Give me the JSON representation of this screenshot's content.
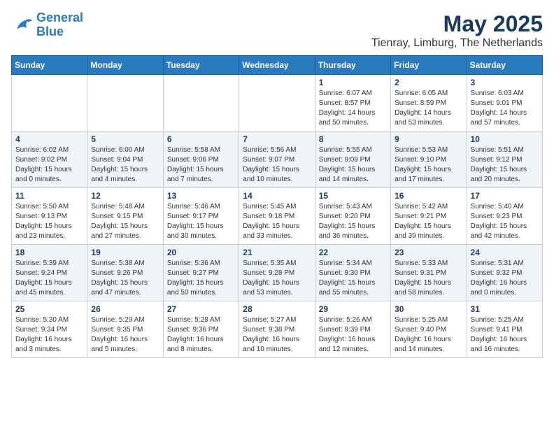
{
  "logo": {
    "line1": "General",
    "line2": "Blue"
  },
  "title": "May 2025",
  "location": "Tienray, Limburg, The Netherlands",
  "weekdays": [
    "Sunday",
    "Monday",
    "Tuesday",
    "Wednesday",
    "Thursday",
    "Friday",
    "Saturday"
  ],
  "weeks": [
    [
      {
        "day": "",
        "info": ""
      },
      {
        "day": "",
        "info": ""
      },
      {
        "day": "",
        "info": ""
      },
      {
        "day": "",
        "info": ""
      },
      {
        "day": "1",
        "info": "Sunrise: 6:07 AM\nSunset: 8:57 PM\nDaylight: 14 hours\nand 50 minutes."
      },
      {
        "day": "2",
        "info": "Sunrise: 6:05 AM\nSunset: 8:59 PM\nDaylight: 14 hours\nand 53 minutes."
      },
      {
        "day": "3",
        "info": "Sunrise: 6:03 AM\nSunset: 9:01 PM\nDaylight: 14 hours\nand 57 minutes."
      }
    ],
    [
      {
        "day": "4",
        "info": "Sunrise: 6:02 AM\nSunset: 9:02 PM\nDaylight: 15 hours\nand 0 minutes."
      },
      {
        "day": "5",
        "info": "Sunrise: 6:00 AM\nSunset: 9:04 PM\nDaylight: 15 hours\nand 4 minutes."
      },
      {
        "day": "6",
        "info": "Sunrise: 5:58 AM\nSunset: 9:06 PM\nDaylight: 15 hours\nand 7 minutes."
      },
      {
        "day": "7",
        "info": "Sunrise: 5:56 AM\nSunset: 9:07 PM\nDaylight: 15 hours\nand 10 minutes."
      },
      {
        "day": "8",
        "info": "Sunrise: 5:55 AM\nSunset: 9:09 PM\nDaylight: 15 hours\nand 14 minutes."
      },
      {
        "day": "9",
        "info": "Sunrise: 5:53 AM\nSunset: 9:10 PM\nDaylight: 15 hours\nand 17 minutes."
      },
      {
        "day": "10",
        "info": "Sunrise: 5:51 AM\nSunset: 9:12 PM\nDaylight: 15 hours\nand 20 minutes."
      }
    ],
    [
      {
        "day": "11",
        "info": "Sunrise: 5:50 AM\nSunset: 9:13 PM\nDaylight: 15 hours\nand 23 minutes."
      },
      {
        "day": "12",
        "info": "Sunrise: 5:48 AM\nSunset: 9:15 PM\nDaylight: 15 hours\nand 27 minutes."
      },
      {
        "day": "13",
        "info": "Sunrise: 5:46 AM\nSunset: 9:17 PM\nDaylight: 15 hours\nand 30 minutes."
      },
      {
        "day": "14",
        "info": "Sunrise: 5:45 AM\nSunset: 9:18 PM\nDaylight: 15 hours\nand 33 minutes."
      },
      {
        "day": "15",
        "info": "Sunrise: 5:43 AM\nSunset: 9:20 PM\nDaylight: 15 hours\nand 36 minutes."
      },
      {
        "day": "16",
        "info": "Sunrise: 5:42 AM\nSunset: 9:21 PM\nDaylight: 15 hours\nand 39 minutes."
      },
      {
        "day": "17",
        "info": "Sunrise: 5:40 AM\nSunset: 9:23 PM\nDaylight: 15 hours\nand 42 minutes."
      }
    ],
    [
      {
        "day": "18",
        "info": "Sunrise: 5:39 AM\nSunset: 9:24 PM\nDaylight: 15 hours\nand 45 minutes."
      },
      {
        "day": "19",
        "info": "Sunrise: 5:38 AM\nSunset: 9:26 PM\nDaylight: 15 hours\nand 47 minutes."
      },
      {
        "day": "20",
        "info": "Sunrise: 5:36 AM\nSunset: 9:27 PM\nDaylight: 15 hours\nand 50 minutes."
      },
      {
        "day": "21",
        "info": "Sunrise: 5:35 AM\nSunset: 9:28 PM\nDaylight: 15 hours\nand 53 minutes."
      },
      {
        "day": "22",
        "info": "Sunrise: 5:34 AM\nSunset: 9:30 PM\nDaylight: 15 hours\nand 55 minutes."
      },
      {
        "day": "23",
        "info": "Sunrise: 5:33 AM\nSunset: 9:31 PM\nDaylight: 15 hours\nand 58 minutes."
      },
      {
        "day": "24",
        "info": "Sunrise: 5:31 AM\nSunset: 9:32 PM\nDaylight: 16 hours\nand 0 minutes."
      }
    ],
    [
      {
        "day": "25",
        "info": "Sunrise: 5:30 AM\nSunset: 9:34 PM\nDaylight: 16 hours\nand 3 minutes."
      },
      {
        "day": "26",
        "info": "Sunrise: 5:29 AM\nSunset: 9:35 PM\nDaylight: 16 hours\nand 5 minutes."
      },
      {
        "day": "27",
        "info": "Sunrise: 5:28 AM\nSunset: 9:36 PM\nDaylight: 16 hours\nand 8 minutes."
      },
      {
        "day": "28",
        "info": "Sunrise: 5:27 AM\nSunset: 9:38 PM\nDaylight: 16 hours\nand 10 minutes."
      },
      {
        "day": "29",
        "info": "Sunrise: 5:26 AM\nSunset: 9:39 PM\nDaylight: 16 hours\nand 12 minutes."
      },
      {
        "day": "30",
        "info": "Sunrise: 5:25 AM\nSunset: 9:40 PM\nDaylight: 16 hours\nand 14 minutes."
      },
      {
        "day": "31",
        "info": "Sunrise: 5:25 AM\nSunset: 9:41 PM\nDaylight: 16 hours\nand 16 minutes."
      }
    ]
  ]
}
